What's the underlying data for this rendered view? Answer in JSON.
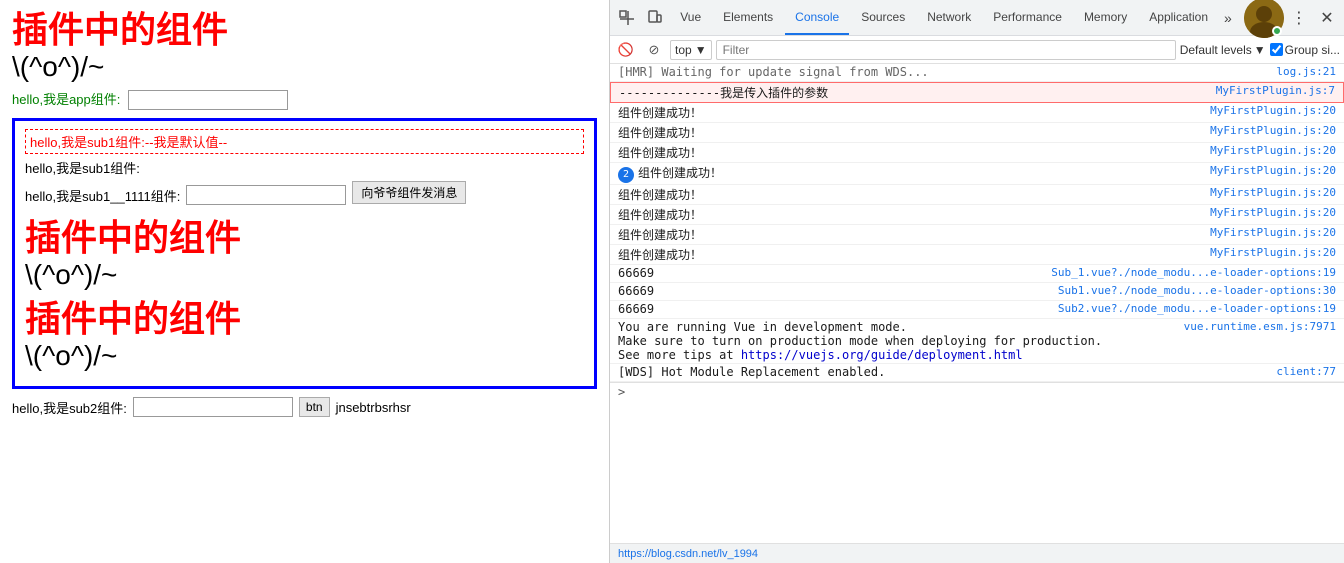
{
  "left": {
    "plugin_title_1": "插件中的组件",
    "plugin_sub_1": "\\(^o^)/~",
    "app_label": "hello,我是app组件:",
    "app_input_value": "",
    "blue_box": {
      "sub1_default": "hello,我是sub1组件:--我是默认值--",
      "sub1_label": "hello,我是sub1组件:",
      "sub1_row_label": "hello,我是sub1__1111组件:",
      "sub1_btn": "向爷爷组件发消息",
      "plugin_title_2": "插件中的组件",
      "plugin_sub_2": "\\(^o^)/~",
      "plugin_title_3": "插件中的组件",
      "plugin_sub_3": "\\(^o^)/~"
    },
    "sub2_label": "hello,我是sub2组件:",
    "sub2_btn": "btn",
    "sub2_text": "jnsebtrbsrhsr"
  },
  "devtools": {
    "tabs": [
      {
        "label": "Vue",
        "active": false
      },
      {
        "label": "Elements",
        "active": false
      },
      {
        "label": "Console",
        "active": true
      },
      {
        "label": "Sources",
        "active": false
      },
      {
        "label": "Network",
        "active": false
      },
      {
        "label": "Performance",
        "active": false
      },
      {
        "label": "Memory",
        "active": false
      },
      {
        "label": "Application",
        "active": false
      }
    ],
    "toolbar": {
      "context": "top",
      "filter_placeholder": "Filter",
      "default_levels": "Default levels",
      "group_similar": "Group si..."
    },
    "console_lines": [
      {
        "msg": "[HMR] Waiting for update signal from WDS...",
        "source": "log.js:21",
        "type": "normal"
      },
      {
        "msg": "--------------我是传入插件的参数",
        "source": "MyFirstPlugin.js:7",
        "type": "highlighted"
      },
      {
        "msg": "组件创建成功！",
        "source": "MyFirstPlugin.js:20",
        "type": "normal"
      },
      {
        "msg": "组件创建成功！",
        "source": "MyFirstPlugin.js:20",
        "type": "normal"
      },
      {
        "msg": "组件创建成功！",
        "source": "MyFirstPlugin.js:20",
        "type": "normal"
      },
      {
        "msg": "组件创建成功！",
        "source": "MyFirstPlugin.js:20",
        "type": "badge",
        "count": 2
      },
      {
        "msg": "组件创建成功！",
        "source": "MyFirstPlugin.js:20",
        "type": "normal"
      },
      {
        "msg": "组件创建成功！",
        "source": "MyFirstPlugin.js:20",
        "type": "normal"
      },
      {
        "msg": "组件创建成功！",
        "source": "MyFirstPlugin.js:20",
        "type": "normal"
      },
      {
        "msg": "组件创建成功！",
        "source": "MyFirstPlugin.js:20",
        "type": "normal"
      },
      {
        "msg": "66669",
        "source": "Sub_1.vue?./node_modu...e-loader-options:19",
        "type": "normal"
      },
      {
        "msg": "66669",
        "source": "Sub1.vue?./node_modu...e-loader-options:30",
        "type": "normal"
      },
      {
        "msg": "66669",
        "source": "Sub2.vue?./node_modu...e-loader-options:19",
        "type": "normal"
      },
      {
        "msg": "You are running Vue in development mode.\nMake sure to turn on production mode when deploying for production.\nSee more tips at https://vuejs.org/guide/deployment.html",
        "source": "vue.runtime.esm.js:7971",
        "type": "normal",
        "multiline": true
      },
      {
        "msg": "[WDS] Hot Module Replacement enabled.",
        "source": "client:77",
        "type": "normal"
      }
    ],
    "bottom_url": "https://blog.csdn.net/lv_1994"
  }
}
